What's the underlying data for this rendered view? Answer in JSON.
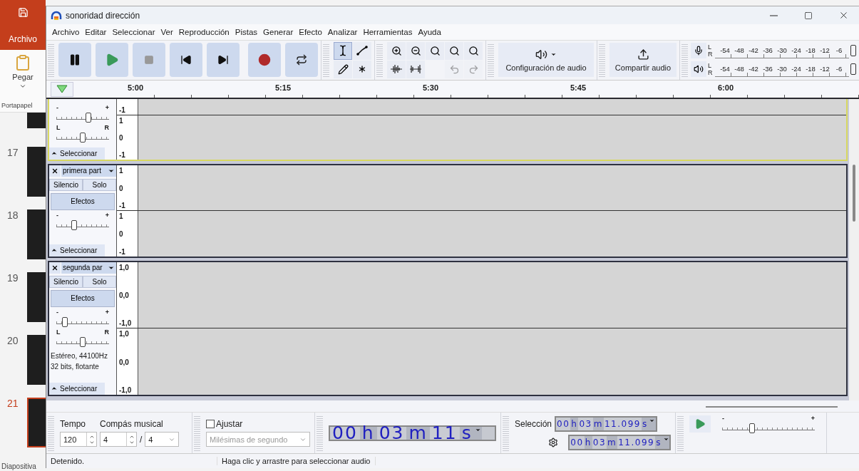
{
  "powerpoint": {
    "file_tab": "Archivo",
    "paste_label": "Pegar",
    "group_label": "Portapapel",
    "status": "Diapositiva",
    "slides": [
      {
        "selected": false
      },
      {
        "number": "17",
        "selected": false
      },
      {
        "number": "18",
        "selected": false
      },
      {
        "number": "19",
        "selected": false
      },
      {
        "number": "20",
        "selected": false
      },
      {
        "number": "21",
        "selected": true
      }
    ]
  },
  "window": {
    "title": "sonoridad dirección"
  },
  "menu": [
    "Archivo",
    "Editar",
    "Seleccionar",
    "Ver",
    "Reproducción",
    "Pistas",
    "Generar",
    "Efecto",
    "Analizar",
    "Herramientas",
    "Ayuda"
  ],
  "transport": [
    {
      "kind": "pause"
    },
    {
      "kind": "play"
    },
    {
      "kind": "stop"
    },
    {
      "kind": "skip_start"
    },
    {
      "kind": "skip_end"
    },
    {
      "kind": "record"
    },
    {
      "kind": "loop"
    }
  ],
  "tools": [
    {
      "kind": "select",
      "selected": true
    },
    {
      "kind": "envelope",
      "selected": false
    },
    {
      "kind": "draw",
      "selected": false
    },
    {
      "kind": "multi",
      "selected": false
    }
  ],
  "edit": [
    {
      "kind": "zoom_in",
      "disabled": false
    },
    {
      "kind": "zoom_out",
      "disabled": false
    },
    {
      "kind": "fit_selection",
      "disabled": false
    },
    {
      "kind": "fit_project",
      "disabled": false
    },
    {
      "kind": "zoom_toggle",
      "disabled": false
    },
    {
      "kind": "trim",
      "disabled": false
    },
    {
      "kind": "silence",
      "disabled": false
    },
    {
      "kind": "undo",
      "disabled": true
    },
    {
      "kind": "redo",
      "disabled": true
    }
  ],
  "audio_setup": {
    "label": "Configuración de audio"
  },
  "share": {
    "label": "Compartir audio"
  },
  "meters": [
    {
      "kind": "recording",
      "channels": [
        "L",
        "R"
      ],
      "ticks": [
        "-54",
        "-48",
        "-42",
        "-36",
        "-30",
        "-24",
        "-18",
        "-12",
        "-6"
      ]
    },
    {
      "kind": "playback",
      "channels": [
        "L",
        "R"
      ],
      "ticks": [
        "-54",
        "-48",
        "-42",
        "-36",
        "-30",
        "-24",
        "-18",
        "-12",
        "-6"
      ]
    }
  ],
  "timeline": {
    "ticks": [
      "5:00",
      "5:15",
      "5:30",
      "5:45",
      "6:00"
    ]
  },
  "tracks": [
    {
      "focused": true,
      "cut_top": true,
      "gain": {
        "min_label": "-",
        "max_label": "+",
        "level": 0.6
      },
      "pan": {
        "min_label": "L",
        "max_label": "R",
        "level": 0.5
      },
      "select_label": "Seleccionar",
      "channels": [
        {
          "scale": [
            "-1"
          ]
        },
        {
          "scale": [
            "1",
            "0",
            "-1"
          ]
        }
      ]
    },
    {
      "focused": false,
      "cut_top": false,
      "name": "primera part",
      "mute_label": "Silencio",
      "solo_label": "Solo",
      "effects_label": "Efectos",
      "gain": {
        "min_label": "-",
        "max_label": "+",
        "level": 0.35
      },
      "select_label": "Seleccionar",
      "channels": [
        {
          "scale": [
            "1",
            "0",
            "-1"
          ]
        },
        {
          "scale": [
            "1",
            "0",
            "-1"
          ]
        }
      ]
    },
    {
      "focused": false,
      "cut_top": false,
      "name": "segunda par",
      "mute_label": "Silencio",
      "solo_label": "Solo",
      "effects_label": "Efectos",
      "gain": {
        "min_label": "-",
        "max_label": "+",
        "level": 0.2
      },
      "pan": {
        "min_label": "L",
        "max_label": "R",
        "level": 0.5
      },
      "info": [
        "Estéreo, 44100Hz",
        "32 bits, flotante"
      ],
      "select_label": "Seleccionar",
      "channels": [
        {
          "scale": [
            "1,0",
            "0,0",
            "-1,0"
          ]
        },
        {
          "scale": [
            "1,0",
            "0,0",
            "-1,0"
          ]
        }
      ]
    }
  ],
  "tempo": {
    "tempo_label": "Tempo",
    "signature_label": "Compás musical",
    "tempo": "120",
    "beats": "4",
    "separator": "/",
    "unit": "4"
  },
  "snap": {
    "label": "Ajustar",
    "checked": false,
    "value": "Milésimas de segundo",
    "disabled": true
  },
  "time": [
    {
      "text": "00",
      "kind": "digits"
    },
    {
      "text": "h",
      "kind": "unit"
    },
    {
      "text": "03",
      "kind": "digits"
    },
    {
      "text": "m",
      "kind": "unit"
    },
    {
      "text": "11",
      "kind": "digits"
    },
    {
      "text": "s",
      "kind": "unit"
    }
  ],
  "selection": {
    "label": "Selección",
    "start": [
      {
        "text": "00",
        "kind": "digits"
      },
      {
        "text": "h",
        "kind": "unit"
      },
      {
        "text": "03",
        "kind": "digits"
      },
      {
        "text": "m",
        "kind": "unit"
      },
      {
        "text": "11.099",
        "kind": "digits"
      },
      {
        "text": "s",
        "kind": "unit"
      }
    ],
    "end": [
      {
        "text": "00",
        "kind": "digits"
      },
      {
        "text": "h",
        "kind": "unit"
      },
      {
        "text": "03",
        "kind": "digits"
      },
      {
        "text": "m",
        "kind": "unit"
      },
      {
        "text": "11.099",
        "kind": "digits"
      },
      {
        "text": "s",
        "kind": "unit"
      }
    ]
  },
  "play_speed": {
    "min_label": "-",
    "max_label": "+",
    "level": 0.33
  },
  "status_bar": [
    "Detenido.",
    "Haga clic y arrastre para seleccionar audio"
  ]
}
